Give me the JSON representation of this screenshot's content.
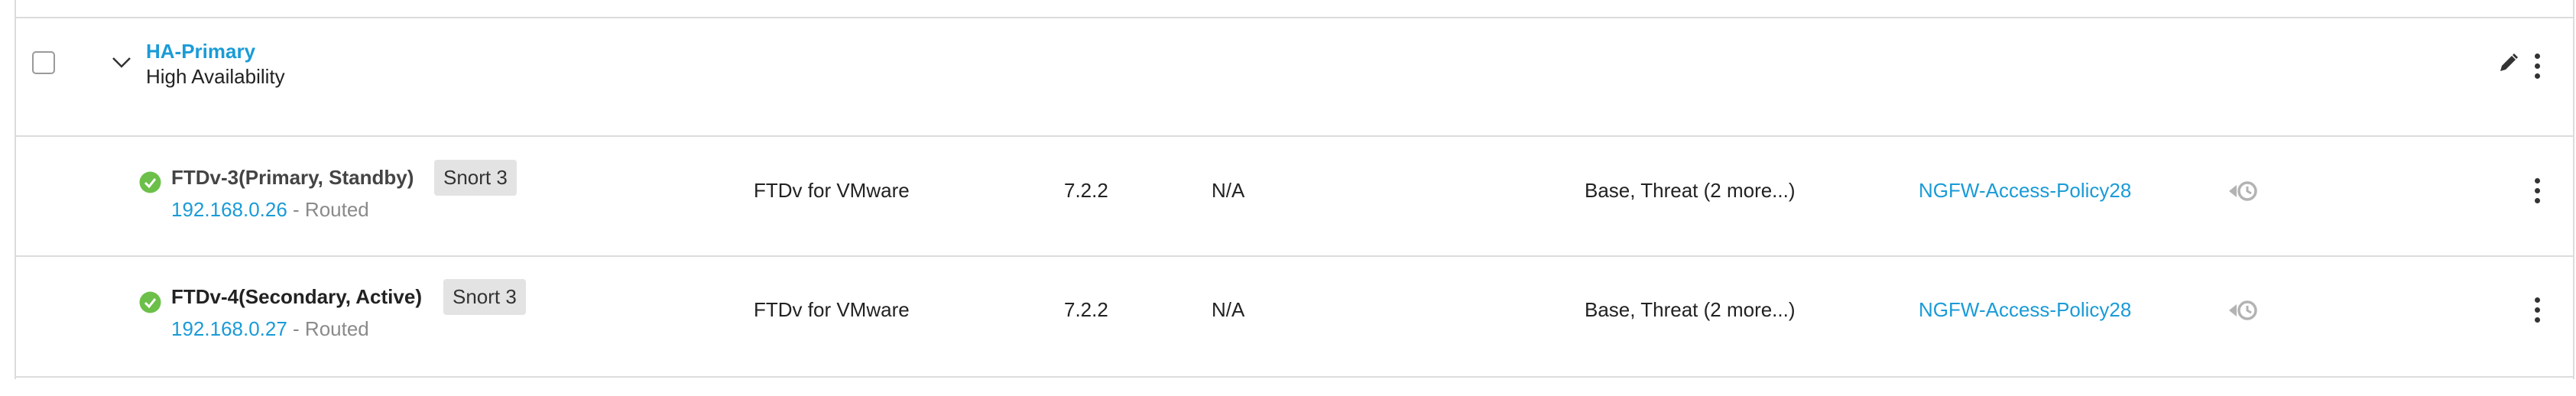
{
  "group": {
    "name": "HA-Primary",
    "type": "High Availability"
  },
  "devices": [
    {
      "name": "FTDv-3(Primary, Standby)",
      "snort": "Snort 3",
      "ip": "192.168.0.26",
      "mode": " - Routed",
      "model": "FTDv for VMware",
      "version": "7.2.2",
      "chassis": "N/A",
      "licenses": "Base, Threat (2 more...)",
      "policy": "NGFW-Access-Policy28",
      "status_icon": "check-circle-icon",
      "status_color": "#6cc04a"
    },
    {
      "name": "FTDv-4(Secondary, Active)",
      "snort": "Snort 3",
      "ip": "192.168.0.27",
      "mode": " - Routed",
      "model": "FTDv for VMware",
      "version": "7.2.2",
      "chassis": "N/A",
      "licenses": "Base, Threat (2 more...)",
      "policy": "NGFW-Access-Policy28",
      "status_icon": "check-circle-icon",
      "status_color": "#6cc04a"
    }
  ],
  "colors": {
    "link": "#1a9bd7",
    "border": "#dcdcdc",
    "badge_bg": "#e3e3e3",
    "success": "#6cc04a"
  }
}
